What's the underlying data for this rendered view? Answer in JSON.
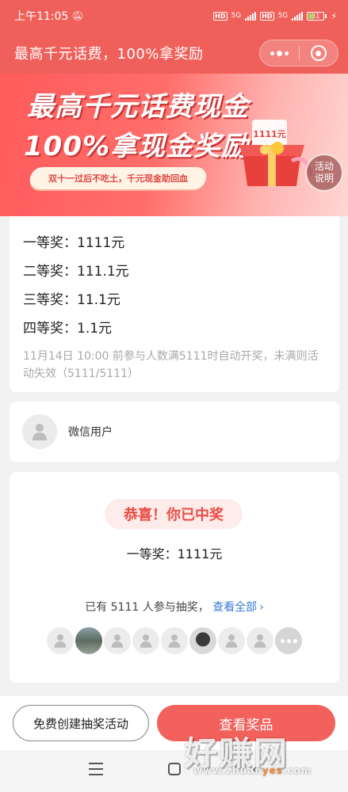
{
  "status_bar": {
    "time": "上午11:05",
    "network_1": "HD",
    "network_1_gen": "5G",
    "network_2": "HD",
    "network_2_gen": "5G",
    "battery": "31"
  },
  "header": {
    "title": "最高千元话费，100%拿奖励"
  },
  "banner": {
    "headline_1": "最高千元话费现金",
    "headline_2": "100%拿现金奖励",
    "tagline": "双十一过后不吃土，千元现金助回血",
    "activity_button": "活动说明",
    "gift_tag": "1111元"
  },
  "prizes": {
    "items": [
      "一等奖：1111元",
      "二等奖：111.1元",
      "三等奖：11.1元",
      "四等奖：1.1元"
    ],
    "note": "11月14日 10:00 前参与人数满5111时自动开奖，未满则活动失效（5111/5111）"
  },
  "user": {
    "name": "微信用户"
  },
  "result": {
    "congrats": "恭喜！你已中奖",
    "won": "一等奖：1111元",
    "participants_pre": "已有",
    "participants_count": "5111",
    "participants_post": "人参与抽奖，",
    "view_all": "查看全部"
  },
  "actions": {
    "create": "免费创建抽奖活动",
    "view_prize": "查看奖品"
  },
  "watermark": {
    "big": "好赚网",
    "small_1": "www.zhuan",
    "small_2": "yes",
    "small_3": ".com"
  },
  "colors": {
    "brand": "#f0605a",
    "link": "#3a7bd5",
    "congrats_text": "#ea4b45"
  }
}
